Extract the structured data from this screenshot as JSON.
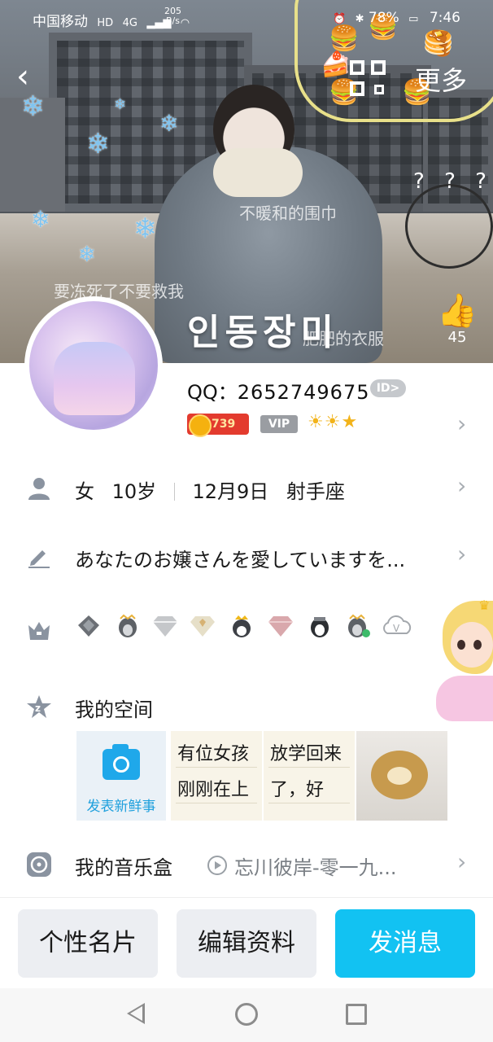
{
  "status_bar": {
    "carrier": "中国移动",
    "carrier_badge": "HD",
    "signal": "4G",
    "net_speed": "205",
    "net_unit": "B/s",
    "battery": "78%",
    "time": "7:46"
  },
  "header": {
    "back_icon": "chevron-left-icon",
    "qr_icon": "qr-code-icon",
    "more_label": "更多"
  },
  "cover": {
    "nickname": "인동장미",
    "overlay_texts": [
      "不暖和的围巾",
      "要冻死了不要救我",
      "肥肥的衣服"
    ],
    "question_marks": "? ? ?",
    "likes": "45"
  },
  "profile": {
    "qq_label": "QQ：",
    "qq_number": "2652749675",
    "id_badge": "ID>",
    "coin_value": "739",
    "vip_label": "VIP",
    "level_icons": "☀☀★"
  },
  "info_rows": {
    "gender": "女",
    "age": "10岁",
    "birthday": "12月9日",
    "zodiac": "射手座",
    "signature": "あなたのお嬢さんを愛していますを..."
  },
  "space": {
    "title": "我的空间",
    "post_label": "发表新鲜事",
    "cards": [
      {
        "line1": "有位女孩",
        "line2": "刚刚在上"
      },
      {
        "line1": "放学回来",
        "line2": "了，好"
      }
    ]
  },
  "music": {
    "title": "我的音乐盒",
    "song": "忘川彼岸-零一九..."
  },
  "buttons": {
    "card": "个性名片",
    "edit": "编辑资料",
    "message": "发消息"
  },
  "colors": {
    "accent": "#12c2f2",
    "icon_grey": "#8a93a0",
    "coin_red": "#e33b2e"
  }
}
